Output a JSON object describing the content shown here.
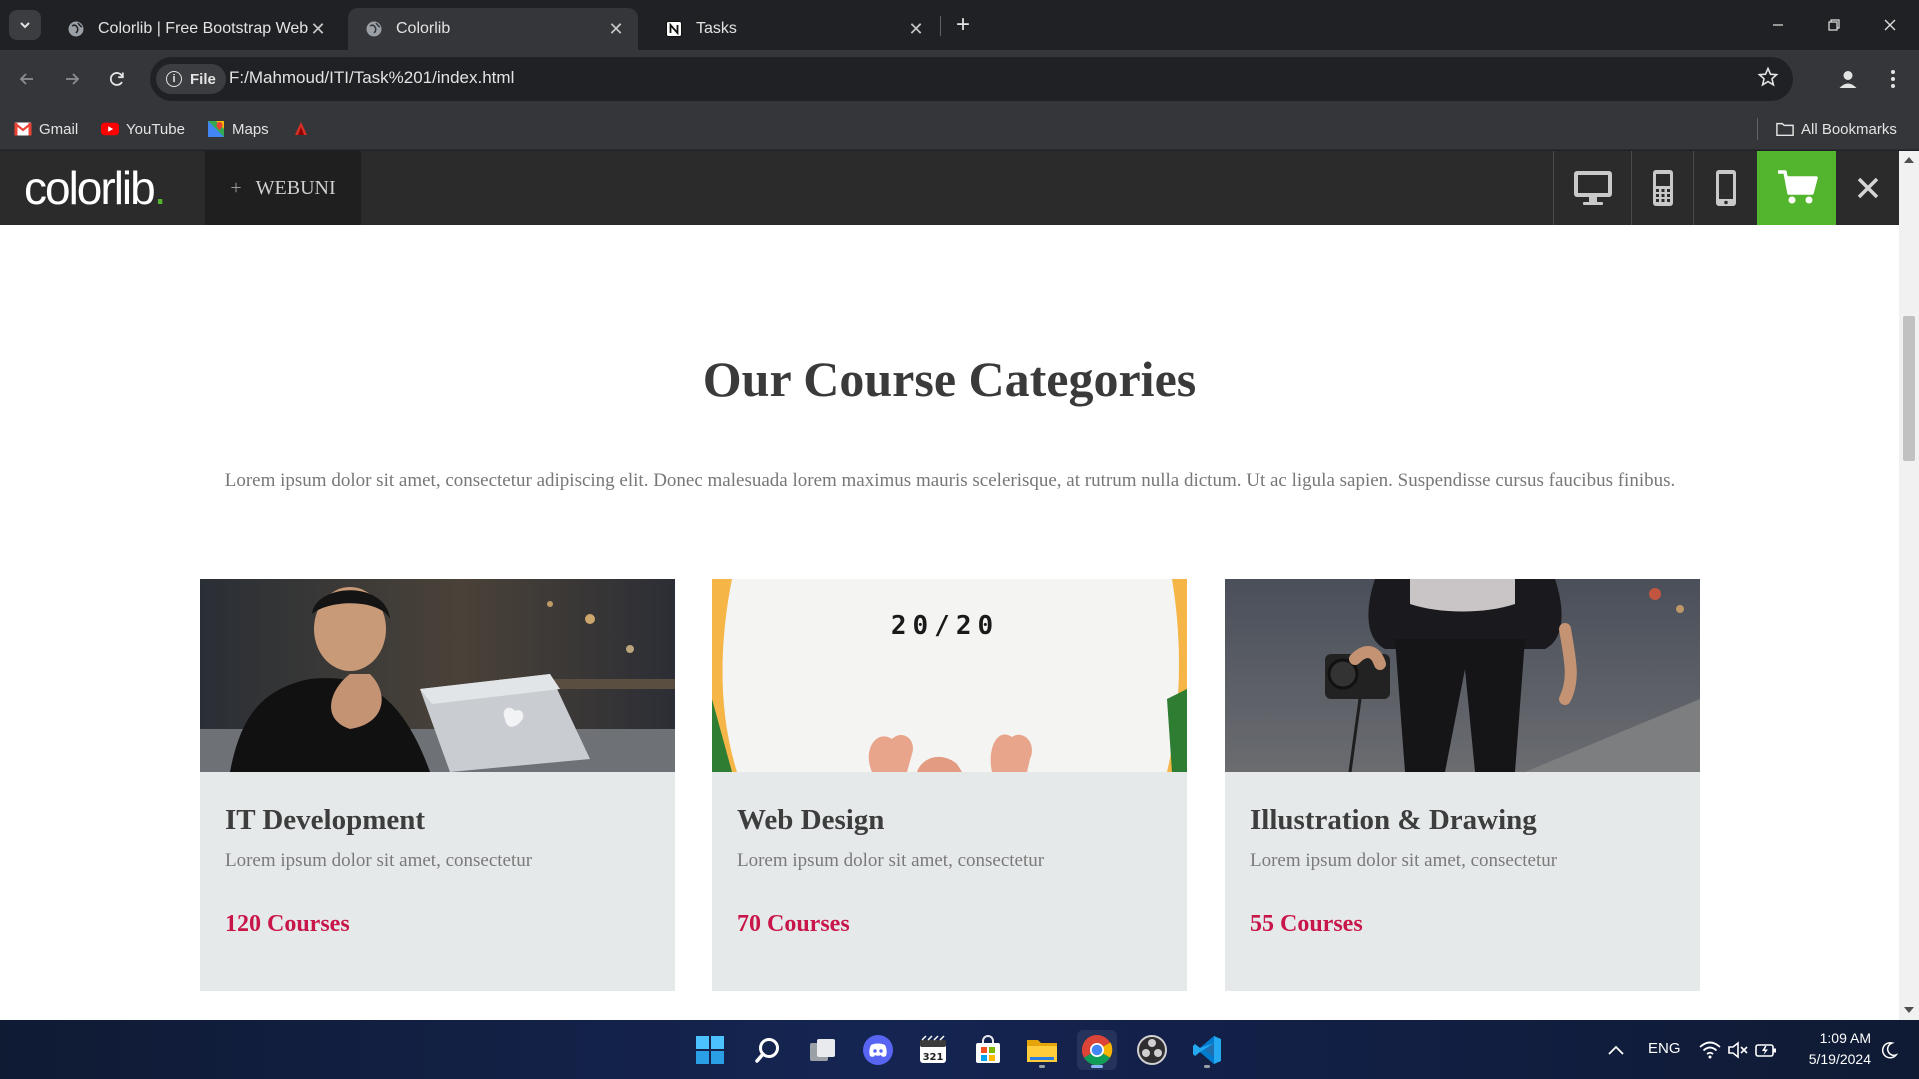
{
  "browser": {
    "tabs": [
      {
        "title": "Colorlib | Free Bootstrap Websit",
        "active": false
      },
      {
        "title": "Colorlib",
        "active": true
      },
      {
        "title": "Tasks",
        "active": false
      }
    ],
    "address": {
      "chip_label": "File",
      "url": "F:/Mahmoud/ITI/Task%201/index.html"
    },
    "bookmarks": [
      {
        "label": "Gmail",
        "icon": "gmail-icon"
      },
      {
        "label": "YouTube",
        "icon": "youtube-icon"
      },
      {
        "label": "Maps",
        "icon": "maps-icon"
      }
    ],
    "all_bookmarks_label": "All Bookmarks"
  },
  "site": {
    "logo_text": "colorlib",
    "logo_dot": ".",
    "theme_label": "WEBUNI",
    "theme_plus": "+",
    "accent_green": "#53b42d",
    "accent_red": "#c8164a"
  },
  "content": {
    "title": "Our Course Categories",
    "description": "Lorem ipsum dolor sit amet, consectetur adipiscing elit. Donec malesuada lorem maximus mauris scelerisque, at rutrum nulla dictum. Ut ac ligula sapien. Suspendisse cursus faucibus finibus.",
    "cards": [
      {
        "title": "IT Development",
        "text": "Lorem ipsum dolor sit amet, consectetur",
        "count": "120 Courses",
        "image": "person-with-laptop"
      },
      {
        "title": "Web Design",
        "text": "Lorem ipsum dolor sit amet, consectetur",
        "count": "70 Courses",
        "image": "white-shirt-20-20",
        "shirt_text": "20/20"
      },
      {
        "title": "Illustration & Drawing",
        "text": "Lorem ipsum dolor sit amet, consectetur",
        "count": "55 Courses",
        "image": "person-holding-camera"
      }
    ]
  },
  "taskbar": {
    "language": "ENG",
    "time": "1:09 AM",
    "date": "5/19/2024"
  }
}
